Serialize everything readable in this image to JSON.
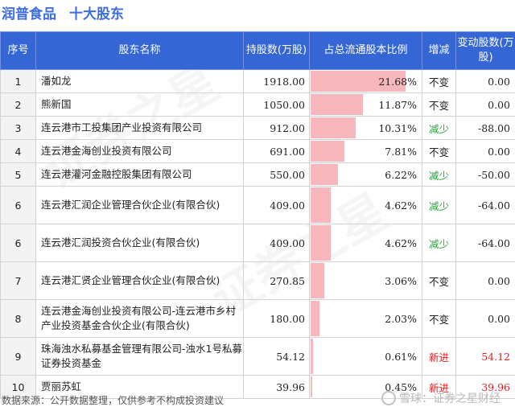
{
  "header": {
    "company": "润普食品",
    "subtitle": "十大股东"
  },
  "table": {
    "columns": [
      "序号",
      "股东名称",
      "持股数(万股)",
      "占总流通股本比例",
      "增减",
      "变动股数(万股)"
    ],
    "rows": [
      {
        "idx": "1",
        "name": "潘如龙",
        "shares": "1918.00",
        "ratio": "21.68%",
        "ratio_value": 21.68,
        "change": "不变",
        "change_kind": "same",
        "delta": "0.00"
      },
      {
        "idx": "2",
        "name": "熊新国",
        "shares": "1050.00",
        "ratio": "11.87%",
        "ratio_value": 11.87,
        "change": "不变",
        "change_kind": "same",
        "delta": "0.00"
      },
      {
        "idx": "3",
        "name": "连云港市工投集团产业投资有限公司",
        "shares": "912.00",
        "ratio": "10.31%",
        "ratio_value": 10.31,
        "change": "减少",
        "change_kind": "dec",
        "delta": "-88.00"
      },
      {
        "idx": "4",
        "name": "连云港金海创业投资有限公司",
        "shares": "691.00",
        "ratio": "7.81%",
        "ratio_value": 7.81,
        "change": "不变",
        "change_kind": "same",
        "delta": "0.00"
      },
      {
        "idx": "5",
        "name": "连云港灌河金融控股集团有限公司",
        "shares": "550.00",
        "ratio": "6.22%",
        "ratio_value": 6.22,
        "change": "减少",
        "change_kind": "dec",
        "delta": "-50.00"
      },
      {
        "idx": "6",
        "name": "连云港汇润企业管理合伙企业(有限合伙)",
        "shares": "409.00",
        "ratio": "4.62%",
        "ratio_value": 4.62,
        "change": "减少",
        "change_kind": "dec",
        "delta": "-64.00"
      },
      {
        "idx": "6",
        "name": "连云港汇润投资合伙企业(有限合伙)",
        "shares": "409.00",
        "ratio": "4.62%",
        "ratio_value": 4.62,
        "change": "减少",
        "change_kind": "dec",
        "delta": "-64.00"
      },
      {
        "idx": "7",
        "name": "连云港汇贤企业管理合伙企业(有限合伙)",
        "shares": "270.85",
        "ratio": "3.06%",
        "ratio_value": 3.06,
        "change": "不变",
        "change_kind": "same",
        "delta": "0.00"
      },
      {
        "idx": "8",
        "name": "连云港金海创业投资有限公司-连云港市乡村产业投资基金合伙企业(有限合伙)",
        "shares": "180.00",
        "ratio": "2.03%",
        "ratio_value": 2.03,
        "change": "不变",
        "change_kind": "same",
        "delta": "0.00"
      },
      {
        "idx": "9",
        "name": "珠海浊水私募基金管理有限公司-浊水1号私募证券投资基金",
        "shares": "54.12",
        "ratio": "0.61%",
        "ratio_value": 0.61,
        "change": "新进",
        "change_kind": "new",
        "delta": "54.12"
      },
      {
        "idx": "10",
        "name": "贾丽苏虹",
        "shares": "39.96",
        "ratio": "0.45%",
        "ratio_value": 0.45,
        "change": "新进",
        "change_kind": "new",
        "delta": "39.96"
      }
    ]
  },
  "footer": {
    "source": "数据来源：公开数据整理，仅供参考不构成投资建议"
  },
  "brand": {
    "text": "雪球：证券之星财经"
  },
  "colors": {
    "accent": "#3566d6",
    "bar": "#f7b7bd",
    "decrease": "#2e9e3e",
    "new": "#e02020"
  },
  "watermark": "证券之星"
}
